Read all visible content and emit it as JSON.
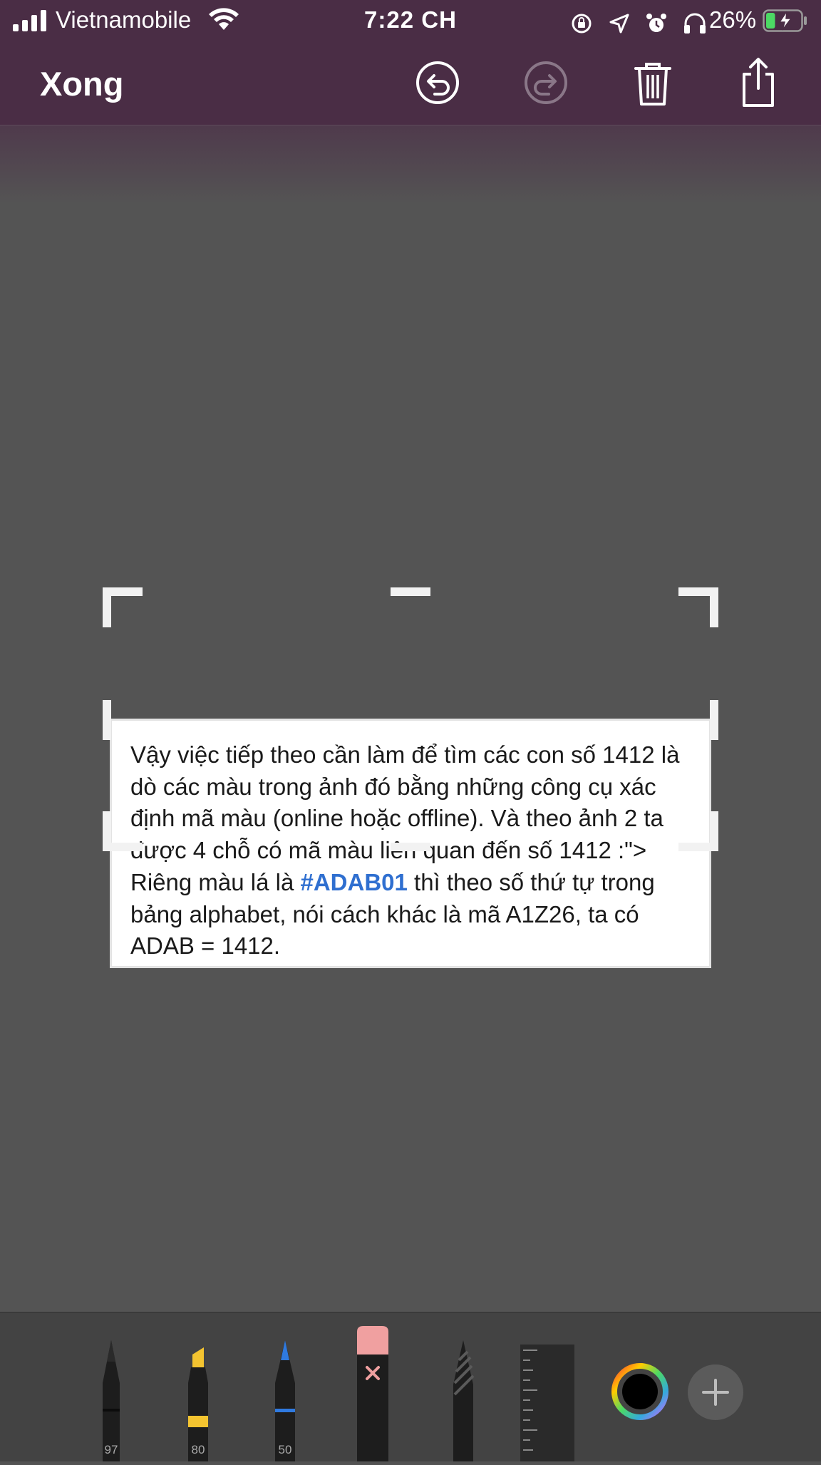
{
  "status_bar": {
    "carrier": "Vietnamobile",
    "time": "7:22 CH",
    "battery_percent": "26%",
    "battery_level": 0.26,
    "icons": [
      "signal-icon",
      "wifi-icon",
      "orientation-lock-icon",
      "location-icon",
      "alarm-icon",
      "headphones-icon",
      "battery-charging-icon"
    ]
  },
  "nav": {
    "done_label": "Xong",
    "buttons": [
      "undo-icon",
      "redo-icon",
      "trash-icon",
      "share-icon"
    ]
  },
  "document": {
    "text_before": "Vậy việc tiếp theo cần làm để tìm các con số 1412 là dò các màu trong ảnh đó bằng những công cụ xác định mã màu (online hoặc offline). Và theo ảnh 2 ta được 4 chỗ có mã màu liên quan đến số 1412 :\"> Riêng màu lá là ",
    "highlight": "#ADAB01",
    "text_after": " thì theo số thứ tự trong bảng alphabet, nói cách khác là mã A1Z26, ta có ADAB = 1412.",
    "highlight_color": "#2f6fd0"
  },
  "tools": {
    "pen_width": "97",
    "marker_width": "80",
    "pencil_width": "50",
    "marker_color": "#f4c430",
    "pencil_color": "#2f7ae0",
    "eraser_color": "#f0a0a0",
    "selected_color": "#000000"
  }
}
